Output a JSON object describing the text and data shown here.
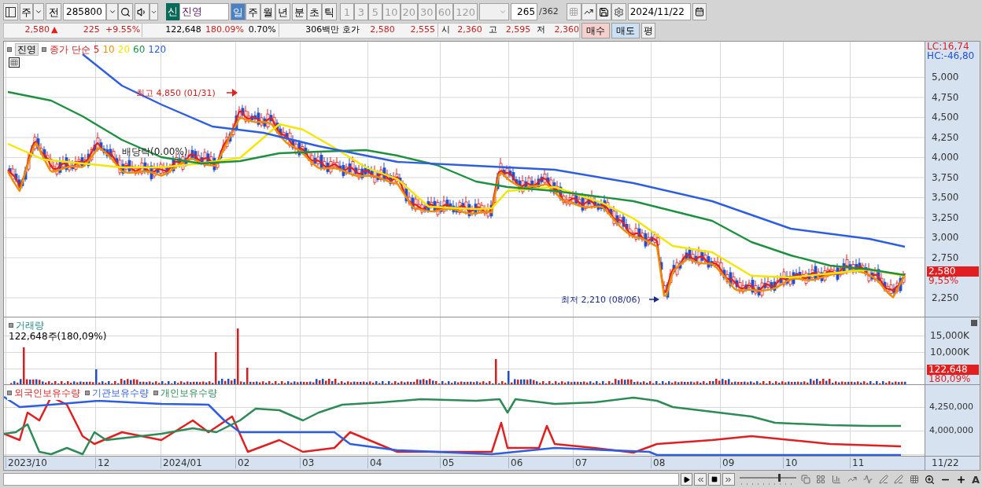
{
  "toolbar": {
    "market": "주",
    "prev_button": "전",
    "code": "285800",
    "name_badge": "신",
    "name": "진영",
    "periods": [
      {
        "label": "일",
        "selected": true
      },
      {
        "label": "주",
        "selected": false
      },
      {
        "label": "월",
        "selected": false
      },
      {
        "label": "년",
        "selected": false
      }
    ],
    "units": [
      {
        "label": "분",
        "selected": false
      },
      {
        "label": "초",
        "selected": false
      },
      {
        "label": "틱",
        "selected": false
      }
    ],
    "intervals": [
      {
        "label": "1",
        "disabled": true
      },
      {
        "label": "3",
        "disabled": true
      },
      {
        "label": "5",
        "disabled": true
      },
      {
        "label": "10",
        "disabled": true
      },
      {
        "label": "20",
        "disabled": true
      },
      {
        "label": "30",
        "disabled": true
      },
      {
        "label": "60",
        "disabled": true
      },
      {
        "label": "120",
        "disabled": true
      }
    ],
    "count": "265",
    "total": "/362",
    "date": "2024/11/22"
  },
  "quote": {
    "price": "2,580",
    "arrow": "▲",
    "change": "225",
    "rate": "+9.55%",
    "volume": "122,648",
    "volume_rate": "180.09%",
    "turnover": "0.70%",
    "amount": "306백만",
    "ask_label": "호가",
    "ask": "2,580",
    "bid": "2,555",
    "open_label": "시",
    "open": "2,360",
    "high_label": "고",
    "high": "2,595",
    "low_label": "저",
    "low": "2,360",
    "buy": "매수",
    "sell": "매도",
    "eval": "평"
  },
  "price_panel": {
    "stock_label": "진영",
    "legend_title": "종가 단순",
    "ma": [
      {
        "label": "5",
        "color": "#e02020"
      },
      {
        "label": "10",
        "color": "#f08c00"
      },
      {
        "label": "20",
        "color": "#f5e600"
      },
      {
        "label": "60",
        "color": "#1e9040"
      },
      {
        "label": "120",
        "color": "#2e5ee0"
      }
    ],
    "lc": "LC:16,74",
    "hc": "HC:-46,80",
    "high_note": "최고 4,850 (01/31)",
    "low_note": "최저 2,210 (08/06)",
    "ex_note": "배당락(0.00%)",
    "yticks": [
      "5,000",
      "4,750",
      "4,500",
      "4,250",
      "4,000",
      "3,750",
      "3,500",
      "3,250",
      "3,000",
      "2,750",
      "2,250"
    ],
    "last_price": "2,580",
    "last_rate": "9,55%"
  },
  "volume_panel": {
    "title": "거래량",
    "summary": "122,648주(180,09%)",
    "yticks": [
      "15,000K",
      "10,000K"
    ],
    "last": "122,648",
    "last_rate": "180,09%"
  },
  "holdings_panel": {
    "series": [
      {
        "label": "외국인보유수량",
        "color": "#e02020"
      },
      {
        "label": "기관보유수량",
        "color": "#2e5ee0"
      },
      {
        "label": "개인보유수량",
        "color": "#2e8b57"
      }
    ],
    "yticks": [
      "4,250,000",
      "4,000,000"
    ]
  },
  "x_axis": [
    "2023/10",
    "12",
    "2024/01",
    "02",
    "03",
    "04",
    "05",
    "06",
    "07",
    "08",
    "09",
    "10",
    "11"
  ],
  "x_axis_last": "11/22",
  "bottom_bar": {
    "font_button": "A",
    "speed_slider": {
      "level": 0.7
    }
  }
}
